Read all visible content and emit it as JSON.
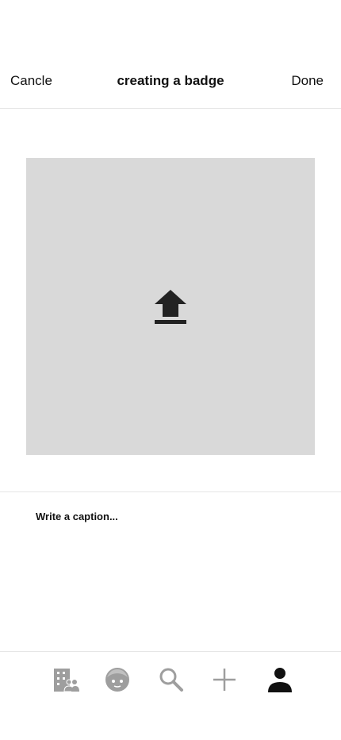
{
  "header": {
    "cancel_label": "Cancle",
    "title": "creating a badge",
    "done_label": "Done"
  },
  "upload": {
    "icon": "upload-icon"
  },
  "caption": {
    "placeholder": "Write a caption..."
  },
  "tabbar": {
    "items": [
      {
        "icon": "organization-icon",
        "active": false
      },
      {
        "icon": "face-icon",
        "active": false
      },
      {
        "icon": "search-icon",
        "active": false
      },
      {
        "icon": "add-icon",
        "active": false
      },
      {
        "icon": "profile-icon",
        "active": true
      }
    ]
  },
  "colors": {
    "background": "#ffffff",
    "upload_area": "#d9d9d9",
    "icon_inactive": "#9e9e9e",
    "icon_active": "#111111",
    "divider": "#e6e6e6"
  }
}
